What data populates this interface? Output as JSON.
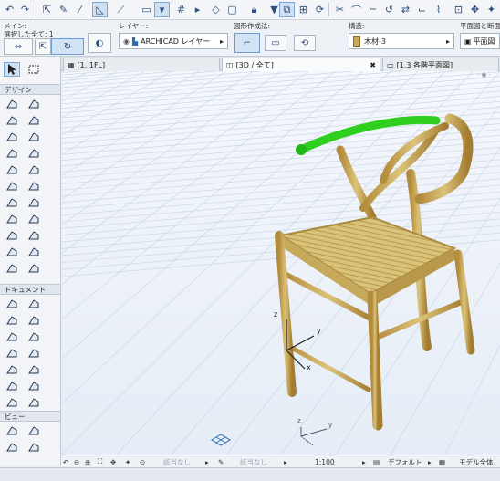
{
  "toolbar": {
    "icons": [
      "undo-icon",
      "redo-icon",
      "pick-icon",
      "eyedropper-icon",
      "measure-icon",
      "angle-icon",
      "guide-icon",
      "layer-icon",
      "grid-icon",
      "snap-icon",
      "cube-icon",
      "lock-icon",
      "filter-icon",
      "link-icon",
      "hotlink-icon",
      "rotate-icon",
      "curve-icon",
      "scissors-icon",
      "offset-icon"
    ]
  },
  "infobox": {
    "main_label": "メイン:",
    "selection_label": "選択した全て: 1",
    "layer_label": "レイヤー:",
    "layer_value": "ARCHICAD レイヤー",
    "geometry_label": "図形作成法:",
    "structure_label": "構造:",
    "structure_value": "木材-3",
    "plan_section_label": "平面図と断面図",
    "plan_section_value": "平面図"
  },
  "toolbox": {
    "design_header": "デザイン",
    "document_header": "ドキュメント",
    "view_header": "ビュー"
  },
  "tabs": [
    {
      "label": "[1. 1FL]"
    },
    {
      "label": "[3D / 全て]"
    },
    {
      "label": "[1.3 各階平面図]"
    }
  ],
  "viewport": {
    "axis_z": "z",
    "axis_y": "y",
    "axis_x": "x",
    "compass_z": "z",
    "compass_y": "y"
  },
  "statusbar": {
    "na1": "該当なし",
    "na2": "該当なし",
    "scale": "1:100",
    "default": "デフォルト",
    "model": "モデル全体"
  },
  "colors": {
    "accent": "#2b6cb0",
    "wood": "#c9a85a",
    "highlight": "#2fcf1f",
    "grid": "#c6d4e6"
  }
}
